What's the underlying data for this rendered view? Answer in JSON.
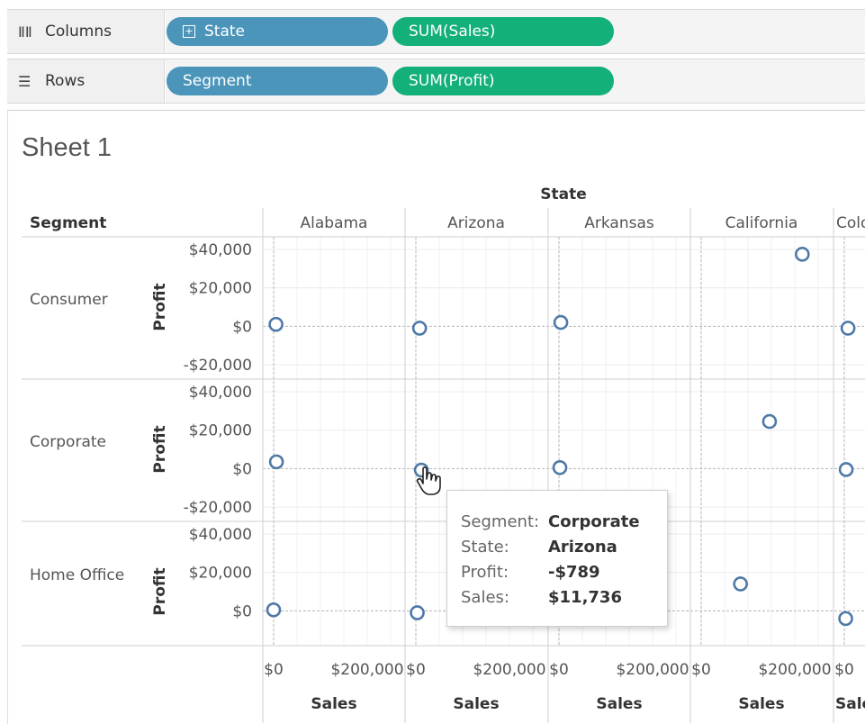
{
  "shelves": {
    "columns": {
      "label": "Columns",
      "pills": [
        "State",
        "SUM(Sales)"
      ]
    },
    "rows": {
      "label": "Rows",
      "pills": [
        "Segment",
        "SUM(Profit)"
      ]
    }
  },
  "sheet": {
    "title": "Sheet 1"
  },
  "view": {
    "column_header": "State",
    "row_header": "Segment",
    "states": [
      "Alabama",
      "Arizona",
      "Arkansas",
      "California",
      "Colo"
    ],
    "segments": [
      "Consumer",
      "Corporate",
      "Home Office"
    ],
    "y_axis_title": "Profit",
    "x_axis_title": "Sales",
    "y_ticks": [
      "$40,000",
      "$20,000",
      "$0",
      "-$20,000"
    ],
    "y_ticks_last": [
      "$40,000",
      "$20,000",
      "$0"
    ],
    "x_ticks": [
      "$0",
      "$200,000"
    ],
    "x_ticks_last": [
      "$0"
    ],
    "x_title_last": "Sale"
  },
  "chart_data": {
    "type": "scatter",
    "x_label": "Sales",
    "y_label": "Profit",
    "xlim": [
      0,
      250000
    ],
    "ylim": [
      -20000,
      40000
    ],
    "points": [
      {
        "segment": "Consumer",
        "state": "Alabama",
        "x": 5000,
        "y": 1000
      },
      {
        "segment": "Consumer",
        "state": "Arizona",
        "x": 8000,
        "y": -1000
      },
      {
        "segment": "Consumer",
        "state": "Arkansas",
        "x": 4000,
        "y": 2000
      },
      {
        "segment": "Consumer",
        "state": "California",
        "x": 216000,
        "y": 37500
      },
      {
        "segment": "Consumer",
        "state": "Colo",
        "x": 8000,
        "y": -1000
      },
      {
        "segment": "Corporate",
        "state": "Alabama",
        "x": 6000,
        "y": 3500
      },
      {
        "segment": "Corporate",
        "state": "Arizona",
        "x": 11736,
        "y": -789
      },
      {
        "segment": "Corporate",
        "state": "Arkansas",
        "x": 2000,
        "y": 500
      },
      {
        "segment": "Corporate",
        "state": "California",
        "x": 146000,
        "y": 24500
      },
      {
        "segment": "Corporate",
        "state": "Colo",
        "x": 4000,
        "y": -500
      },
      {
        "segment": "Home Office",
        "state": "Alabama",
        "x": 0,
        "y": 500
      },
      {
        "segment": "Home Office",
        "state": "Arizona",
        "x": 3000,
        "y": -1000
      },
      {
        "segment": "Home Office",
        "state": "California",
        "x": 84000,
        "y": 14000
      },
      {
        "segment": "Home Office",
        "state": "Colo",
        "x": 3000,
        "y": -4000
      }
    ]
  },
  "tooltip": {
    "rows": [
      {
        "label": "Segment:",
        "value": "Corporate"
      },
      {
        "label": "State:",
        "value": "Arizona"
      },
      {
        "label": "Profit:",
        "value": "-$789"
      },
      {
        "label": "Sales:",
        "value": "$11,736"
      }
    ]
  },
  "colors": {
    "mark": "#4e79a7",
    "dimension_pill": "#4b95ba",
    "measure_pill": "#13b07a"
  }
}
